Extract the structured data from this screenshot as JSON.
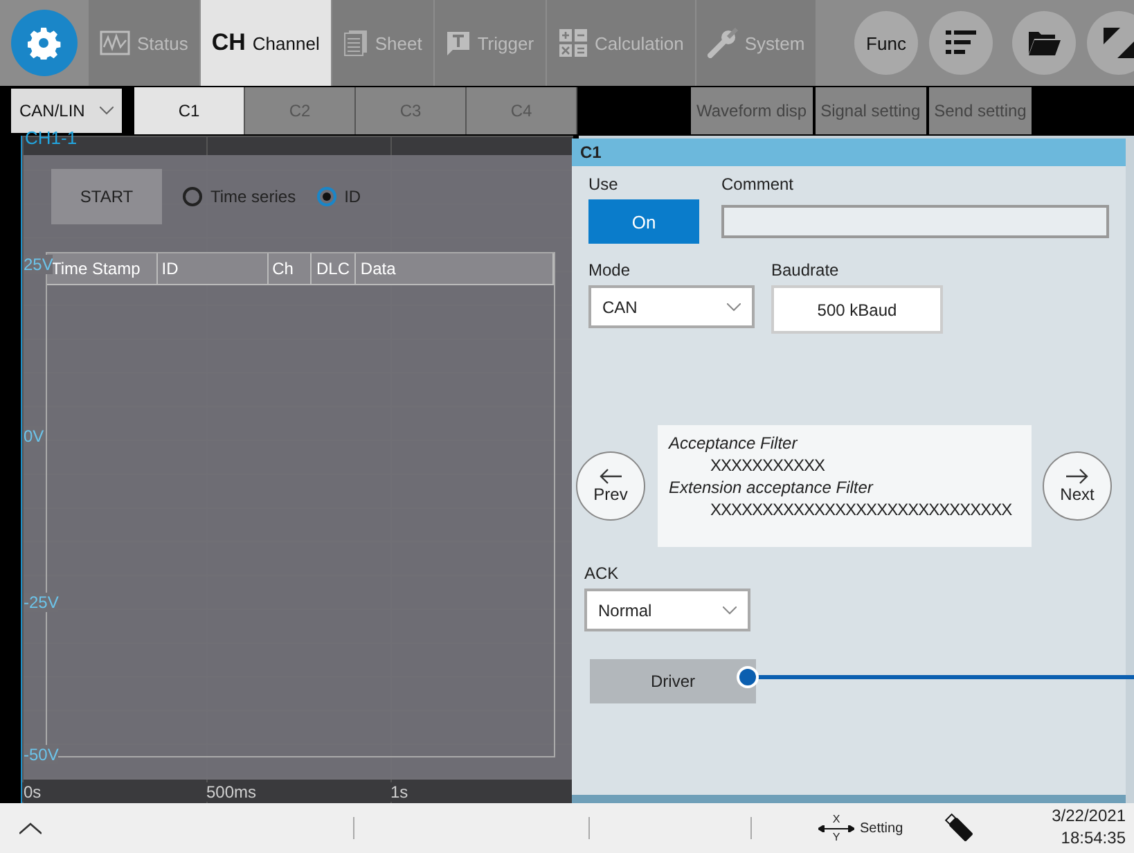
{
  "top_tabs": [
    {
      "label": "Status",
      "selected": false
    },
    {
      "label": "Channel",
      "icon_text": "CH",
      "selected": true
    },
    {
      "label": "Sheet",
      "selected": false
    },
    {
      "label": "Trigger",
      "selected": false
    },
    {
      "label": "Calculation",
      "selected": false
    },
    {
      "label": "System",
      "selected": false
    }
  ],
  "func_button": "Func",
  "mode_dropdown": "CAN/LIN",
  "channel_tabs": [
    {
      "label": "C1",
      "selected": true
    },
    {
      "label": "C2",
      "selected": false
    },
    {
      "label": "C3",
      "selected": false
    },
    {
      "label": "C4",
      "selected": false
    }
  ],
  "view_buttons": [
    "Waveform disp",
    "Signal setting",
    "Send setting"
  ],
  "waveform": {
    "channel_label": "CH1-1",
    "y_labels": [
      "25V",
      "0V",
      "-25V",
      "-50V"
    ],
    "x_labels": [
      "0s",
      "500ms",
      "1s"
    ]
  },
  "can_monitor": {
    "start_button": "START",
    "display_options": [
      {
        "label": "Time series",
        "selected": false
      },
      {
        "label": "ID",
        "selected": true
      }
    ],
    "columns": [
      "Time Stamp",
      "ID",
      "Ch",
      "DLC",
      "Data"
    ]
  },
  "dialog": {
    "title": "C1",
    "use": {
      "label": "Use",
      "value": "On",
      "on": true
    },
    "comment": {
      "label": "Comment"
    },
    "mode": {
      "label": "Mode",
      "value": "CAN"
    },
    "baudrate": {
      "label": "Baudrate",
      "value": "500 kBaud"
    },
    "prev": "Prev",
    "next": "Next",
    "filters": [
      {
        "label": "Acceptance Filter",
        "value": "XXXXXXXXXXX"
      },
      {
        "label": "Extension acceptance Filter",
        "value": "XXXXXXXXXXXXXXXXXXXXXXXXXXXXX"
      }
    ],
    "ack": {
      "label": "ACK",
      "value": "Normal"
    },
    "driver_button": "Driver"
  },
  "status_bar": {
    "axis_labels": [
      "X",
      "Y"
    ],
    "setting": "Setting",
    "date": "3/22/2021",
    "time": "18:54:35"
  }
}
